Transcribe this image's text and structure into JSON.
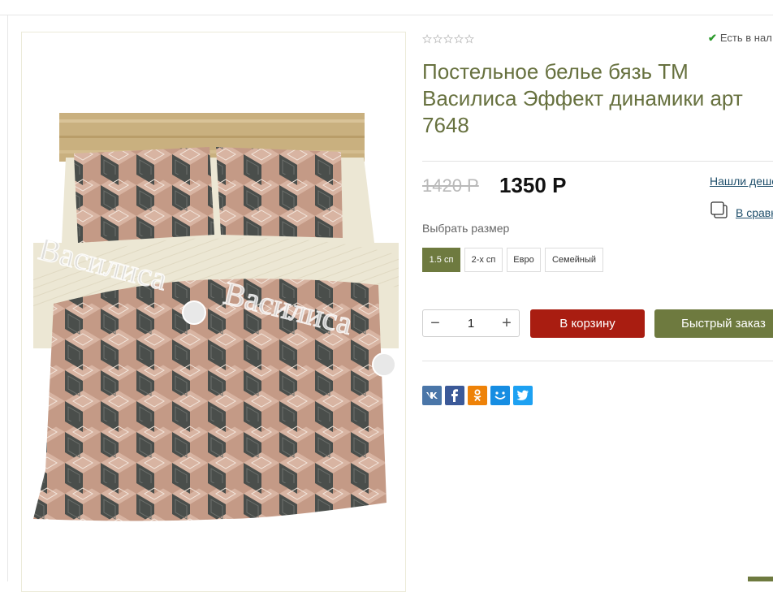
{
  "rating": {
    "stars": 0,
    "max": 5
  },
  "stock": {
    "label": "Есть в нал"
  },
  "product": {
    "title": "Постельное белье бязь ТМ Василиса Эффект динамики арт 7648",
    "old_price": "1420 Р",
    "price": "1350 Р",
    "watermark": "Василиса"
  },
  "links": {
    "cheaper": "Нашли деше",
    "compare": "В сравн"
  },
  "size": {
    "label": "Выбрать размер",
    "options": [
      "1.5 сп",
      "2-х сп",
      "Евро",
      "Семейный"
    ],
    "selected": "1.5 сп"
  },
  "quantity": {
    "value": "1",
    "minus": "−",
    "plus": "+"
  },
  "buttons": {
    "cart": "В корзину",
    "fast_order": "Быстрый заказ"
  },
  "socials": [
    "vk-icon",
    "facebook-icon",
    "odnoklassniki-icon",
    "moimir-icon",
    "twitter-icon"
  ],
  "colors": {
    "brand_green": "#6e7a3f",
    "title_green": "#67713f",
    "cart_red": "#a91d11",
    "link_blue": "#1f4f6b"
  }
}
